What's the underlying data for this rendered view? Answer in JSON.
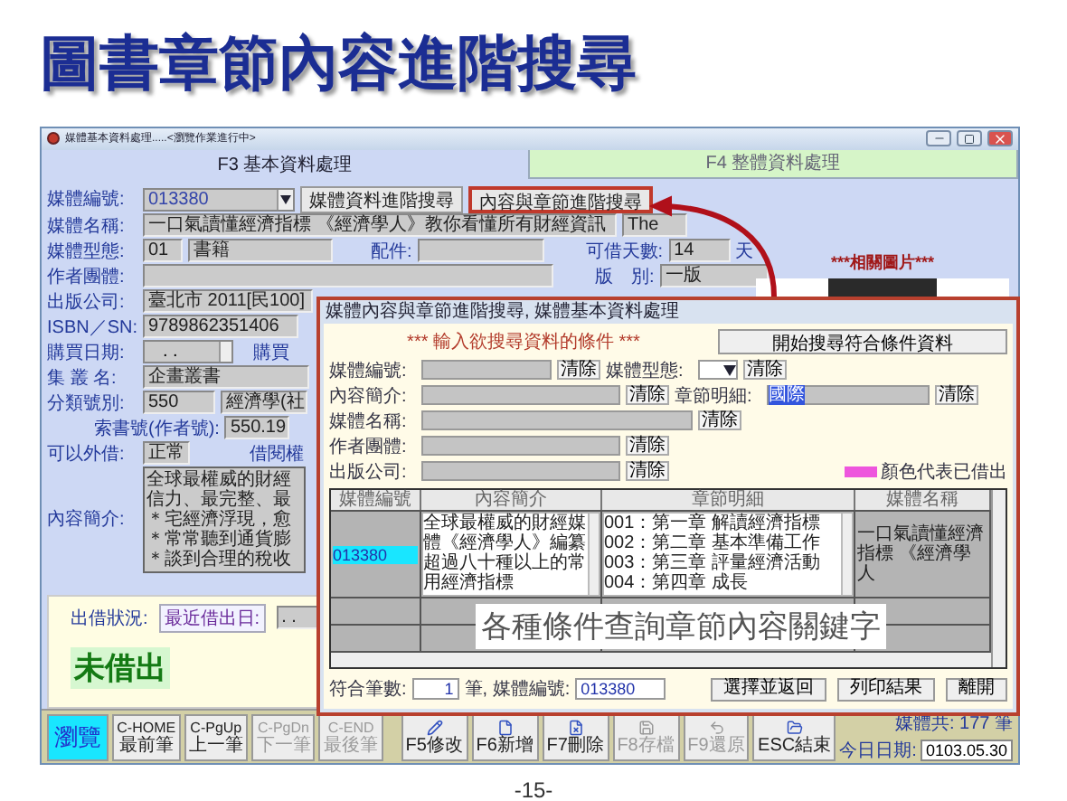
{
  "slide": {
    "title": "圖書章節內容進階搜尋",
    "page_number": "-15-"
  },
  "window": {
    "title": "媒體基本資料處理.....<瀏覽作業進行中>"
  },
  "tabs": [
    {
      "label": "F3 基本資料處理",
      "selected": true
    },
    {
      "label": "F4 整體資料處理",
      "selected": false
    }
  ],
  "form": {
    "rows": [
      {
        "label": "媒體編號:",
        "items": [
          {
            "kind": "dropdown",
            "value": "013380"
          },
          {
            "kind": "button",
            "label": "媒體資料進階搜尋",
            "highlighted": false
          },
          {
            "kind": "button",
            "label": "內容與章節進階搜尋",
            "highlighted": true
          }
        ]
      },
      {
        "label": "媒體名稱:",
        "items": [
          {
            "kind": "field",
            "value": "一口氣讀懂經濟指標 《經濟學人》教你看懂所有財經資訊"
          },
          {
            "kind": "field",
            "value": "The"
          }
        ]
      },
      {
        "label": "媒體型態:",
        "items": [
          {
            "kind": "field",
            "value": "01"
          },
          {
            "kind": "field",
            "value": "書籍"
          },
          {
            "kind": "label",
            "text": "配件:"
          },
          {
            "kind": "field"
          },
          {
            "kind": "label",
            "text": "可借天數:"
          },
          {
            "kind": "field",
            "value": "14"
          },
          {
            "kind": "label",
            "text": "天"
          }
        ]
      },
      {
        "label": "作者團體:",
        "items": [
          {
            "kind": "field"
          },
          {
            "kind": "label",
            "text": "版　別:"
          },
          {
            "kind": "field",
            "value": "一版"
          }
        ]
      },
      {
        "label": "出版公司:",
        "items": [
          {
            "kind": "field",
            "value": "臺北市 2011[民100]"
          }
        ]
      },
      {
        "label": "ISBN／SN:",
        "items": [
          {
            "kind": "field",
            "value": "9789862351406"
          }
        ]
      },
      {
        "label": "購買日期:",
        "items": [
          {
            "kind": "spinner",
            "value": ".  ."
          },
          {
            "kind": "label",
            "text": "購買"
          }
        ]
      },
      {
        "label": "集 叢 名:",
        "items": [
          {
            "kind": "field",
            "value": "企畫叢書"
          }
        ]
      },
      {
        "label": "分類號別:",
        "items": [
          {
            "kind": "field",
            "value": "550"
          },
          {
            "kind": "field",
            "value": "經濟學(社"
          }
        ]
      },
      {
        "items": [
          {
            "kind": "label",
            "text": "索書號(作者號):"
          },
          {
            "kind": "field",
            "value": "550.19"
          }
        ]
      },
      {
        "label": "可以外借:",
        "items": [
          {
            "kind": "field",
            "value": "正常"
          },
          {
            "kind": "label",
            "text": "借閱權"
          }
        ]
      },
      {
        "label": "內容簡介:",
        "items": [
          {
            "kind": "textarea",
            "lines": [
              "全球最權威的財經",
              "信力、最完整、最",
              "＊宅經濟浮現，愈",
              "＊常常聽到通貨膨",
              "＊談到合理的稅收"
            ]
          }
        ]
      }
    ]
  },
  "picture_panel": {
    "title": "***相關圖片***"
  },
  "loan": {
    "label": "出借狀況:",
    "last_loan_label": "最近借出日:",
    "last_loan_value": ".  .",
    "status": "未借出"
  },
  "toolbar": {
    "buttons": [
      {
        "kind": "text",
        "lines": [
          "瀏覽"
        ],
        "selected": true,
        "disabled": false
      },
      {
        "kind": "text",
        "lines": [
          "C-HOME",
          "最前筆"
        ],
        "selected": false,
        "disabled": false
      },
      {
        "kind": "text",
        "lines": [
          "C-PgUp",
          "上一筆"
        ],
        "selected": false,
        "disabled": false
      },
      {
        "kind": "text",
        "lines": [
          "C-PgDn",
          "下一筆"
        ],
        "selected": false,
        "disabled": true
      },
      {
        "kind": "text",
        "lines": [
          "C-END",
          "最後筆"
        ],
        "selected": false,
        "disabled": true
      },
      {
        "kind": "icon",
        "lines": [
          "F5修改"
        ],
        "selected": false,
        "disabled": false
      },
      {
        "kind": "icon",
        "lines": [
          "F6新增"
        ],
        "selected": false,
        "disabled": false
      },
      {
        "kind": "icon",
        "lines": [
          "F7刪除"
        ],
        "selected": false,
        "disabled": false
      },
      {
        "kind": "icon",
        "lines": [
          "F8存檔"
        ],
        "selected": false,
        "disabled": true
      },
      {
        "kind": "icon",
        "lines": [
          "F9還原"
        ],
        "selected": false,
        "disabled": true
      },
      {
        "kind": "icon",
        "lines": [
          "ESC結束"
        ],
        "selected": false,
        "disabled": false
      }
    ],
    "total": "媒體共: 177 筆",
    "date_label": "今日日期:",
    "date": "0103.05.30"
  },
  "dialog": {
    "title": "媒體內容與章節進階搜尋, 媒體基本資料處理",
    "heading": "*** 輸入欲搜尋資料的條件 ***",
    "search_button": "開始搜尋符合條件資料",
    "criteria": [
      [
        {
          "kind": "label",
          "text": "媒體編號:"
        },
        {
          "kind": "field"
        },
        {
          "kind": "button",
          "label": "清除"
        },
        {
          "kind": "label",
          "text": "媒體型態:"
        },
        {
          "kind": "dropdown"
        },
        {
          "kind": "button",
          "label": "清除"
        }
      ],
      [
        {
          "kind": "label",
          "text": "內容簡介:"
        },
        {
          "kind": "field"
        },
        {
          "kind": "button",
          "label": "清除"
        },
        {
          "kind": "label",
          "text": "章節明細:"
        },
        {
          "kind": "field",
          "value": "國際",
          "highlighted": true
        },
        {
          "kind": "button",
          "label": "清除"
        }
      ],
      [
        {
          "kind": "label",
          "text": "媒體名稱:"
        },
        {
          "kind": "field"
        },
        {
          "kind": "button",
          "label": "清除"
        }
      ],
      [
        {
          "kind": "label",
          "text": "作者團體:"
        },
        {
          "kind": "field"
        },
        {
          "kind": "button",
          "label": "清除"
        }
      ],
      [
        {
          "kind": "label",
          "text": "出版公司:"
        },
        {
          "kind": "field"
        },
        {
          "kind": "button",
          "label": "清除"
        },
        {
          "kind": "legend",
          "color": "#ee55dd",
          "text": "顏色代表已借出"
        }
      ]
    ],
    "columns": [
      "媒體編號",
      "內容簡介",
      "章節明細",
      "媒體名稱"
    ],
    "rows": [
      {
        "media_id": "013380",
        "selected": true,
        "content": "全球最權威的財經媒體《經濟學人》編纂超過八十種以上的常用經濟指標",
        "chapters": [
          "001：第一章 解讀經濟指標",
          "002：第二章 基本準備工作",
          "003：第三章 評量經濟活動",
          "004：第四章 成長"
        ],
        "name": "一口氣讀懂經濟指標 《經濟學人"
      }
    ],
    "caption": "各種條件查詢章節內容關鍵字",
    "footer": {
      "count_label": "符合筆數:",
      "count": "1",
      "id_label": "筆, 媒體編號:",
      "id_value": "013380",
      "buttons": [
        "選擇並返回",
        "列印結果",
        "離開"
      ]
    }
  }
}
